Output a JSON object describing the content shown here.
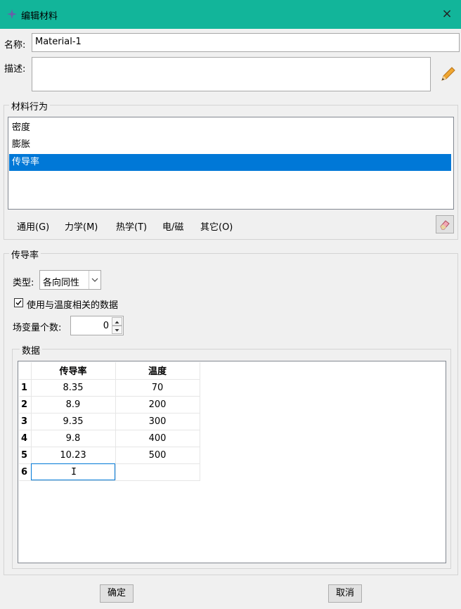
{
  "window": {
    "title": "编辑材料",
    "close_glyph": "×"
  },
  "name": {
    "label": "名称:",
    "value": "Material-1"
  },
  "description": {
    "label": "描述:",
    "value": ""
  },
  "behaviors": {
    "title": "材料行为",
    "items": [
      {
        "label": "密度",
        "selected": false
      },
      {
        "label": "膨胀",
        "selected": false
      },
      {
        "label": "传导率",
        "selected": true
      }
    ],
    "menu": [
      "通用(G)",
      "力学(M)",
      "热学(T)",
      "电/磁",
      "其它(O)"
    ]
  },
  "section": {
    "title": "传导率",
    "type_label": "类型:",
    "type_value": "各向同性",
    "temp_checkbox_label": "使用与温度相关的数据",
    "temp_checked": true,
    "field_vars_label": "场变量个数:",
    "field_vars_value": "0",
    "data_title": "数据"
  },
  "table": {
    "headers": [
      "传导率",
      "温度"
    ],
    "rows": [
      {
        "n": "1",
        "k": "8.35",
        "t": "70"
      },
      {
        "n": "2",
        "k": "8.9",
        "t": "200"
      },
      {
        "n": "3",
        "k": "9.35",
        "t": "300"
      },
      {
        "n": "4",
        "k": "9.8",
        "t": "400"
      },
      {
        "n": "5",
        "k": "10.23",
        "t": "500"
      },
      {
        "n": "6",
        "k": "",
        "t": ""
      }
    ]
  },
  "buttons": {
    "ok": "确定",
    "cancel": "取消"
  },
  "icons": {
    "title": "material-icon",
    "edit": "pencil-icon",
    "eraser": "eraser-icon"
  },
  "colors": {
    "titlebar": "#12b59a",
    "selection": "#0078d7"
  }
}
